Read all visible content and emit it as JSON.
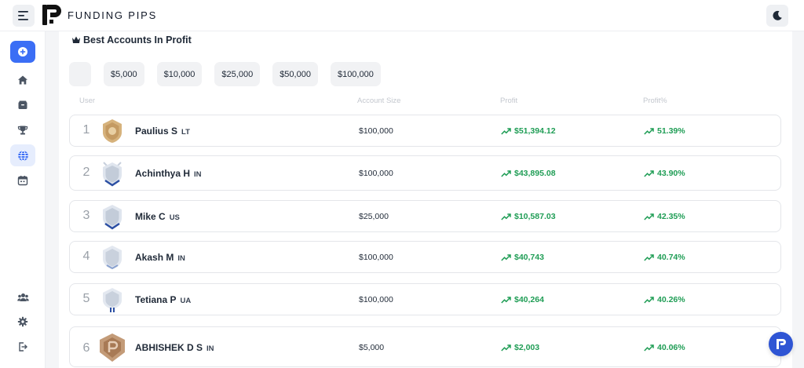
{
  "brand": {
    "name": "FUNDING PIPS"
  },
  "section": {
    "title": "Best Accounts In Profit"
  },
  "filters": [
    "$5,000",
    "$10,000",
    "$25,000",
    "$50,000",
    "$100,000"
  ],
  "columns": {
    "user": "User",
    "account_size": "Account Size",
    "profit": "Profit",
    "profit_pct": "Profit%"
  },
  "rows": [
    {
      "rank": "1",
      "name": "Paulius S",
      "country": "LT",
      "size": "$100,000",
      "profit": "$51,394.12",
      "pct": "51.39%",
      "badge": "gold"
    },
    {
      "rank": "2",
      "name": "Achinthya H",
      "country": "IN",
      "size": "$100,000",
      "profit": "$43,895.08",
      "pct": "43.90%",
      "badge": "silver"
    },
    {
      "rank": "3",
      "name": "Mike C",
      "country": "US",
      "size": "$25,000",
      "profit": "$10,587.03",
      "pct": "42.35%",
      "badge": "silver"
    },
    {
      "rank": "4",
      "name": "Akash M",
      "country": "IN",
      "size": "$100,000",
      "profit": "$40,743",
      "pct": "40.74%",
      "badge": "silver"
    },
    {
      "rank": "5",
      "name": "Tetiana P",
      "country": "UA",
      "size": "$100,000",
      "profit": "$40,264",
      "pct": "40.26%",
      "badge": "silver"
    },
    {
      "rank": "6",
      "name": "ABHISHEK D S",
      "country": "IN",
      "size": "$5,000",
      "profit": "$2,003",
      "pct": "40.06%",
      "badge": "bronze"
    }
  ],
  "colors": {
    "accent": "#3b6ef5",
    "profit": "#1f9d55",
    "gold": "#c9a36b",
    "silver": "#c7cfdc",
    "bronze": "#b88a66"
  },
  "icons": {
    "sidebar": [
      "plus-icon",
      "home-icon",
      "wallet-icon",
      "trophy-icon",
      "globe-icon",
      "calendar-icon"
    ],
    "sidebar_bottom": [
      "users-icon",
      "gear-icon",
      "logout-icon"
    ]
  }
}
